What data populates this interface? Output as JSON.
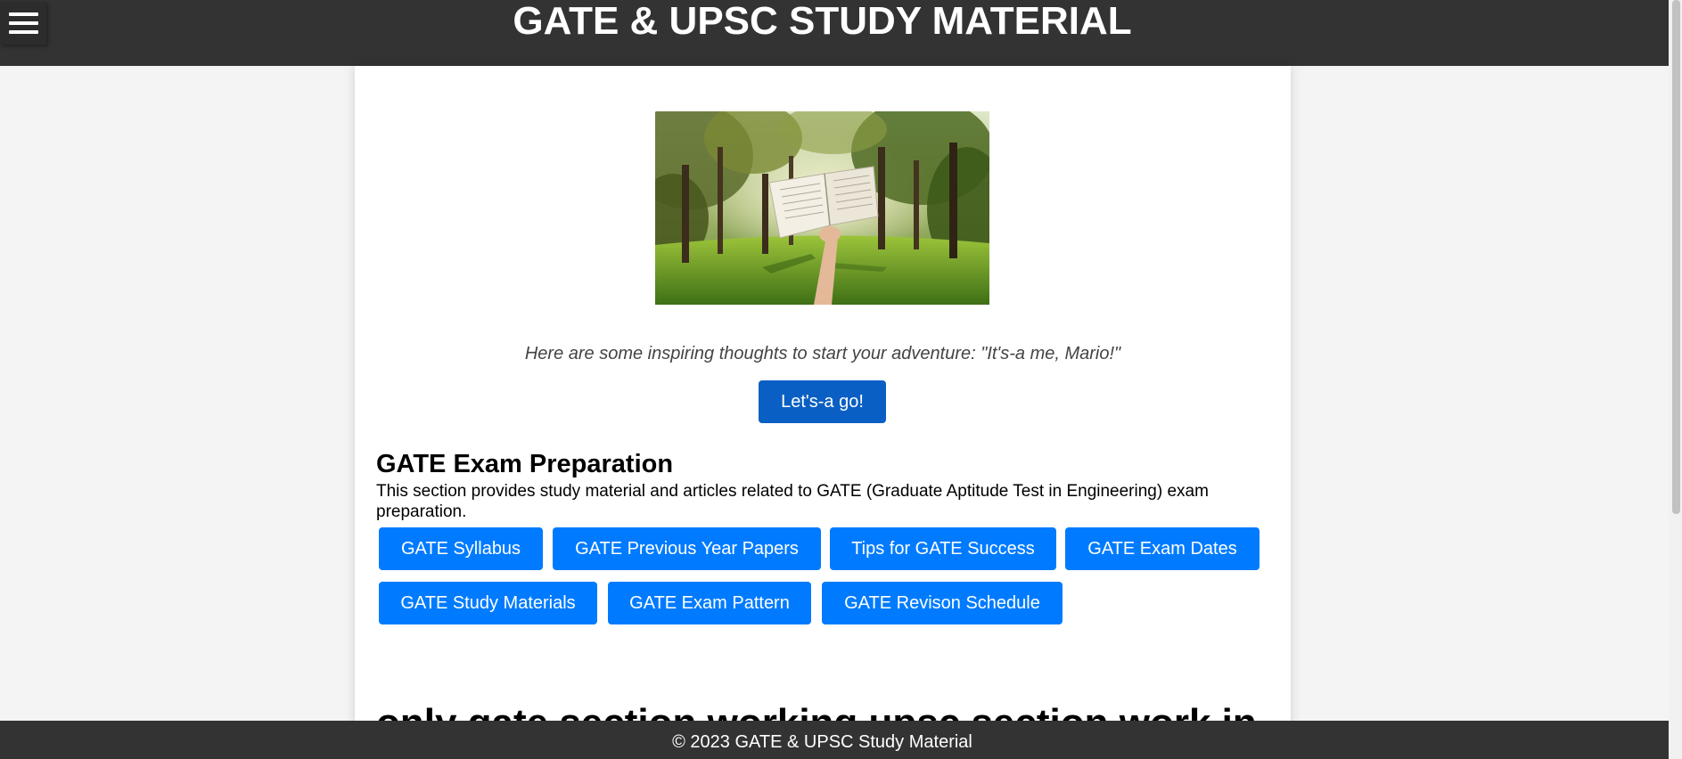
{
  "header": {
    "title": "GATE & UPSC STUDY MATERIAL",
    "menu_icon": "hamburger-menu-icon"
  },
  "hero": {
    "image": "hand holding open book in sunlit forest park"
  },
  "intro": {
    "quote": "Here are some inspiring thoughts to start your adventure: \"It's-a me, Mario!\"",
    "cta_label": "Let's-a go!"
  },
  "gate_section": {
    "heading": "GATE Exam Preparation",
    "description": "This section provides study material and articles related to GATE (Graduate Aptitude Test in Engineering) exam preparation.",
    "links": [
      "GATE Syllabus",
      "GATE Previous Year Papers",
      "Tips for GATE Success",
      "GATE Exam Dates",
      "GATE Study Materials",
      "GATE Exam Pattern",
      "GATE Revison Schedule"
    ]
  },
  "next_section": {
    "heading": "only gate section working upsc section work in"
  },
  "footer": {
    "text": "© 2023 GATE & UPSC Study Material"
  },
  "colors": {
    "header_bg": "#333333",
    "primary_button": "#007bff",
    "cta_button": "#0a5fc4",
    "page_bg": "#f4f4f4",
    "card_bg": "#ffffff"
  }
}
